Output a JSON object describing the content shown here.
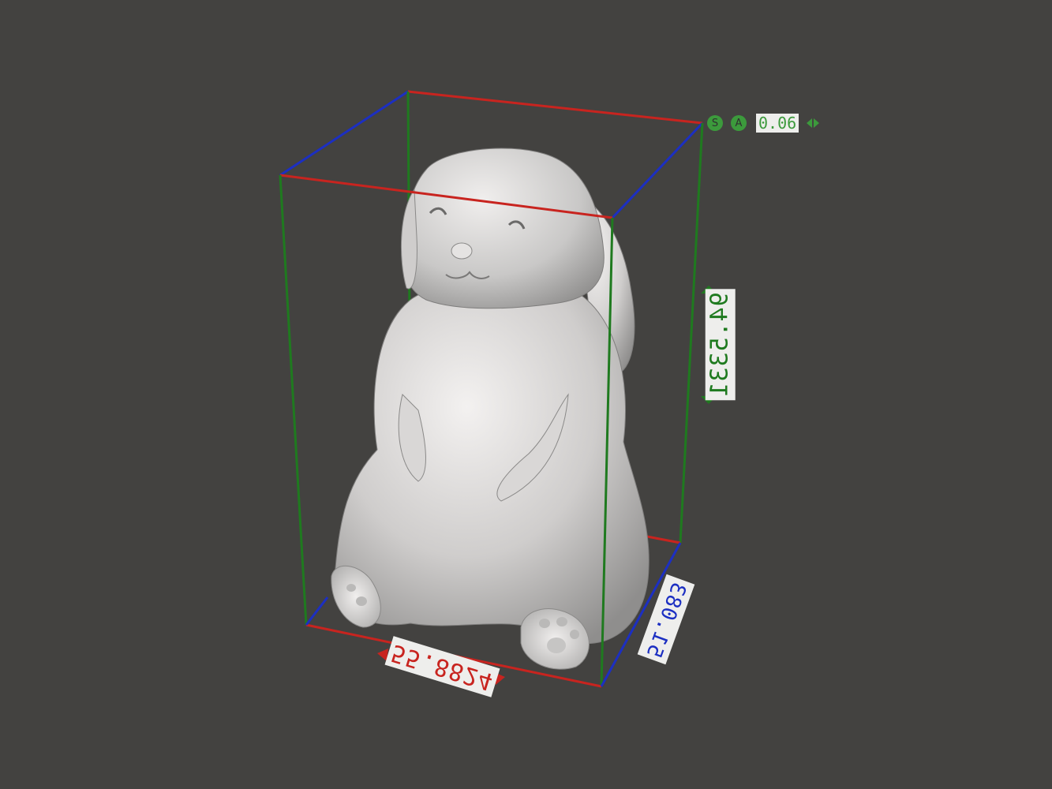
{
  "viewport": {
    "background": "#434240",
    "model": "bunny-mesh",
    "bounding_box_colors": {
      "x": "#c8241f",
      "y": "#1f7a1f",
      "z": "#1c2fc2"
    }
  },
  "dimensions": {
    "x_label": "55.8824",
    "y_label": "94.5331",
    "z_label": "51.083"
  },
  "snap": {
    "s_button": "S",
    "a_button": "A",
    "value": "0.06",
    "left_icon": "triangle-left-icon",
    "right_icon": "triangle-right-icon"
  }
}
